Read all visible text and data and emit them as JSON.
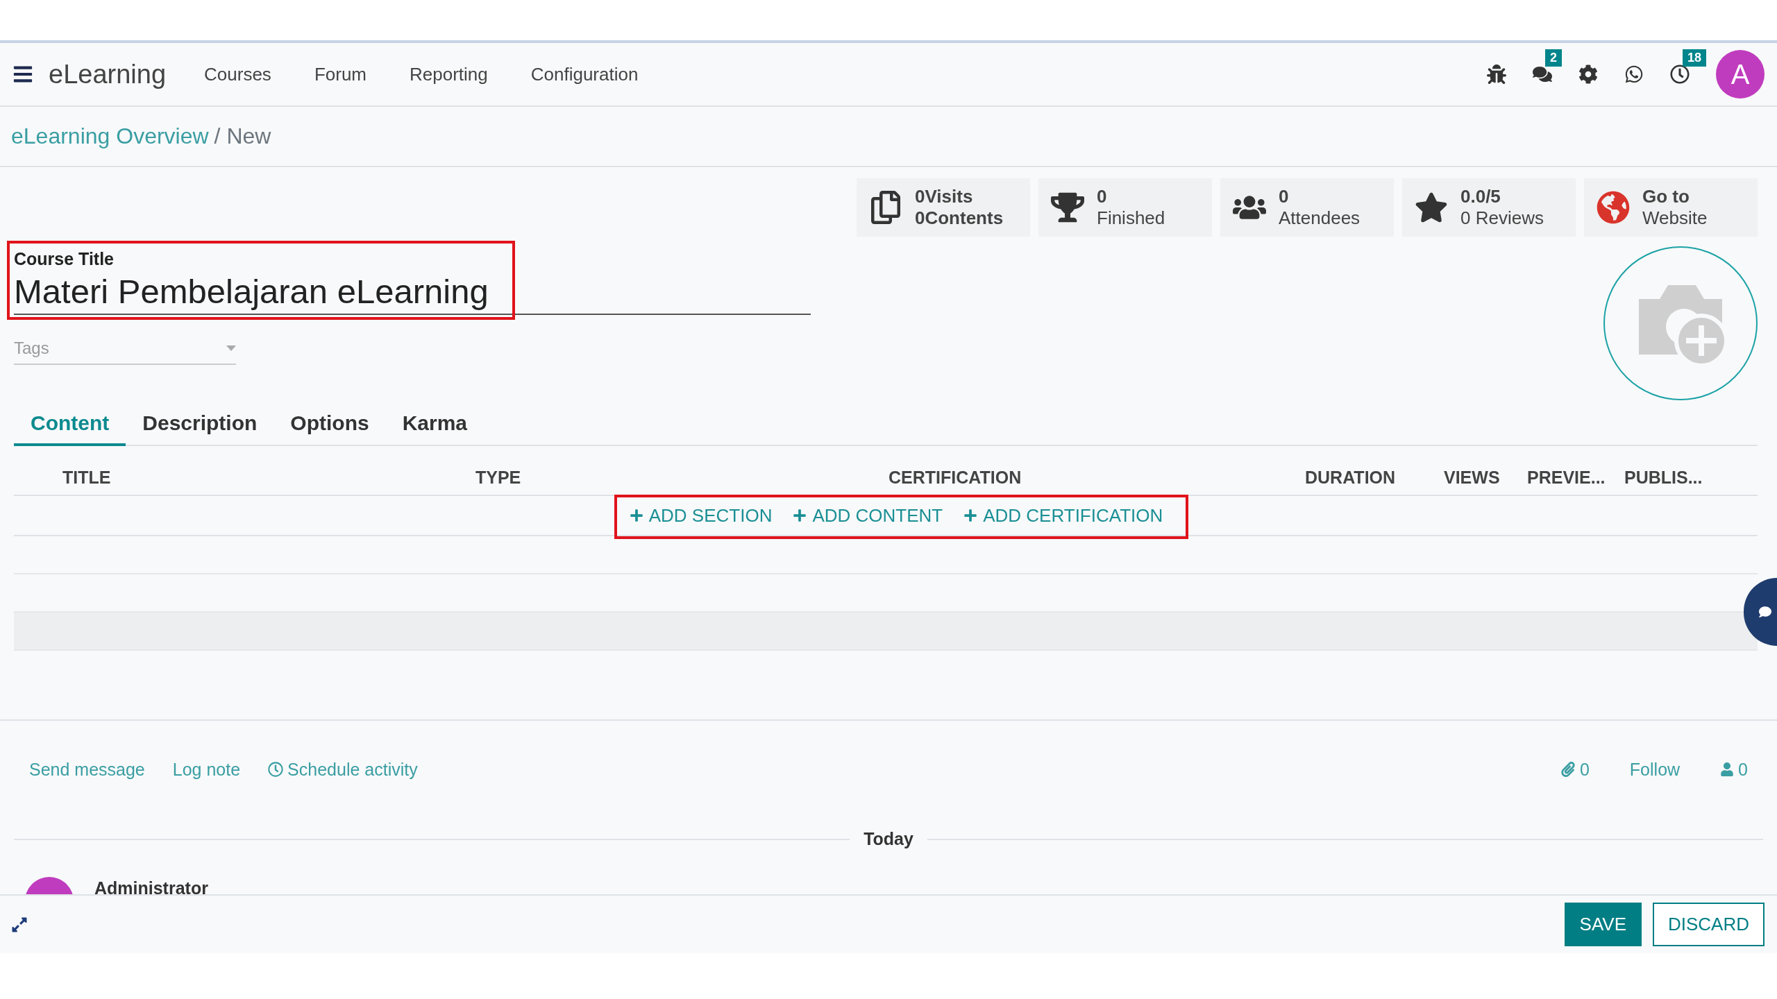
{
  "navbar": {
    "brand": "eLearning",
    "menu": [
      "Courses",
      "Forum",
      "Reporting",
      "Configuration"
    ],
    "systray": [
      {
        "kind": "bug"
      },
      {
        "kind": "chat",
        "badge": "2"
      },
      {
        "kind": "gear"
      },
      {
        "kind": "whatsapp"
      },
      {
        "kind": "clock",
        "badge": "18"
      }
    ],
    "avatar": "A"
  },
  "breadcrumb": {
    "parent": "eLearning Overview",
    "separator": "/",
    "current": "New"
  },
  "stats": [
    {
      "kind": "pages",
      "value": "0Visits",
      "label": "0Contents"
    },
    {
      "kind": "trophy",
      "value": "0",
      "label": "Finished"
    },
    {
      "kind": "users",
      "value": "0",
      "label": "Attendees"
    },
    {
      "kind": "star",
      "value": "0.0/5",
      "label": "0 Reviews"
    },
    {
      "kind": "globe",
      "value": "Go to",
      "label": "Website"
    }
  ],
  "form": {
    "title_label": "Course Title",
    "title_value": "Materi Pembelajaran eLearning",
    "tags_placeholder": "Tags"
  },
  "tabs": [
    {
      "label": "Content",
      "selected": true
    },
    {
      "label": "Description",
      "selected": false
    },
    {
      "label": "Options",
      "selected": false
    },
    {
      "label": "Karma",
      "selected": false
    }
  ],
  "table": {
    "columns": [
      "TITLE",
      "TYPE",
      "CERTIFICATION",
      "DURATION",
      "VIEWS",
      "PREVIE...",
      "PUBLIS..."
    ],
    "actions": [
      "ADD SECTION",
      "ADD CONTENT",
      "ADD CERTIFICATION"
    ]
  },
  "chatter": {
    "actions": [
      "Send message",
      "Log note",
      "Schedule activity"
    ],
    "attachments": "0",
    "follow": "Follow",
    "followers": "0",
    "date_separator": "Today",
    "author": "Administrator"
  },
  "footer": {
    "buttons": [
      {
        "label": "SAVE",
        "kind": "primary"
      },
      {
        "label": "DISCARD",
        "kind": "secondary"
      }
    ]
  }
}
